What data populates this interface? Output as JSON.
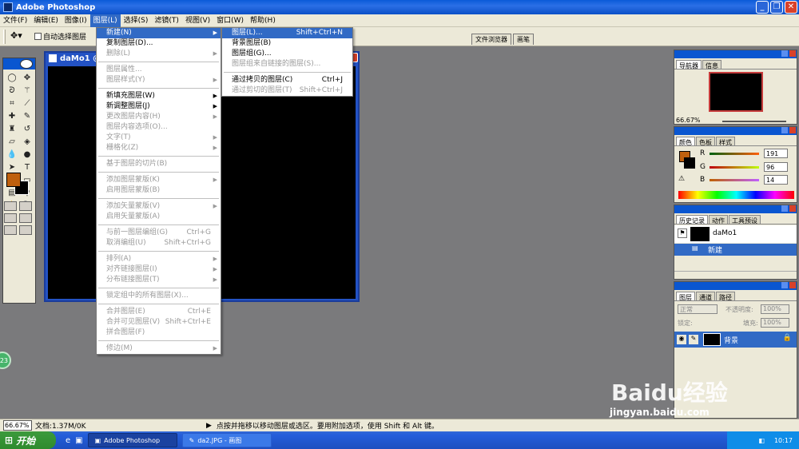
{
  "window": {
    "title": "Adobe Photoshop"
  },
  "menubar": {
    "items": [
      "文件(F)",
      "编辑(E)",
      "图像(I)",
      "图层(L)",
      "选择(S)",
      "滤镜(T)",
      "视图(V)",
      "窗口(W)",
      "帮助(H)"
    ]
  },
  "options": {
    "auto_select_label": "自动选择图层"
  },
  "well_tabs": [
    "文件浏览器",
    "画笔"
  ],
  "document": {
    "title": "daMo1 @"
  },
  "layer_menu": {
    "items": [
      {
        "label": "新建(N)",
        "state": "highlight",
        "arrow": true
      },
      {
        "label": "复制图层(D)...",
        "state": "normal"
      },
      {
        "label": "删除(L)",
        "state": "disabled",
        "arrow": true
      },
      {
        "sep": true
      },
      {
        "label": "图层属性...",
        "state": "disabled"
      },
      {
        "label": "图层样式(Y)",
        "state": "disabled",
        "arrow": true
      },
      {
        "sep": true
      },
      {
        "label": "新填充图层(W)",
        "state": "normal",
        "arrow": true
      },
      {
        "label": "新调整图层(J)",
        "state": "normal",
        "arrow": true
      },
      {
        "label": "更改图层内容(H)",
        "state": "disabled",
        "arrow": true
      },
      {
        "label": "图层内容选项(O)...",
        "state": "disabled"
      },
      {
        "label": "文字(T)",
        "state": "disabled",
        "arrow": true
      },
      {
        "label": "栅格化(Z)",
        "state": "disabled",
        "arrow": true
      },
      {
        "sep": true
      },
      {
        "label": "基于图层的切片(B)",
        "state": "disabled"
      },
      {
        "sep": true
      },
      {
        "label": "添加图层蒙版(K)",
        "state": "disabled",
        "arrow": true
      },
      {
        "label": "启用图层蒙版(B)",
        "state": "disabled"
      },
      {
        "sep": true
      },
      {
        "label": "添加矢量蒙版(V)",
        "state": "disabled",
        "arrow": true
      },
      {
        "label": "启用矢量蒙版(A)",
        "state": "disabled"
      },
      {
        "sep": true
      },
      {
        "label": "与前一图层编组(G)",
        "state": "disabled",
        "shortcut": "Ctrl+G"
      },
      {
        "label": "取消编组(U)",
        "state": "disabled",
        "shortcut": "Shift+Ctrl+G"
      },
      {
        "sep": true
      },
      {
        "label": "排列(A)",
        "state": "disabled",
        "arrow": true
      },
      {
        "label": "对齐链接图层(I)",
        "state": "disabled",
        "arrow": true
      },
      {
        "label": "分布链接图层(T)",
        "state": "disabled",
        "arrow": true
      },
      {
        "sep": true
      },
      {
        "label": "锁定组中的所有图层(X)...",
        "state": "disabled"
      },
      {
        "sep": true
      },
      {
        "label": "合并图层(E)",
        "state": "disabled",
        "shortcut": "Ctrl+E"
      },
      {
        "label": "合并可见图层(V)",
        "state": "disabled",
        "shortcut": "Shift+Ctrl+E"
      },
      {
        "label": "拼合图层(F)",
        "state": "disabled"
      },
      {
        "sep": true
      },
      {
        "label": "修边(M)",
        "state": "disabled",
        "arrow": true
      }
    ]
  },
  "new_submenu": {
    "items": [
      {
        "label": "图层(L)...",
        "state": "highlight",
        "shortcut": "Shift+Ctrl+N"
      },
      {
        "label": "背景图层(B)",
        "state": "normal"
      },
      {
        "label": "图层组(G)...",
        "state": "normal"
      },
      {
        "label": "图层组来自链接的图层(S)...",
        "state": "disabled"
      },
      {
        "sep": true
      },
      {
        "label": "通过拷贝的图层(C)",
        "state": "normal",
        "shortcut": "Ctrl+J"
      },
      {
        "label": "通过剪切的图层(T)",
        "state": "disabled",
        "shortcut": "Shift+Ctrl+J"
      }
    ]
  },
  "navigator": {
    "tabs": [
      "导航器",
      "信息"
    ],
    "zoom": "66.67%"
  },
  "color": {
    "tabs": [
      "颜色",
      "色板",
      "样式"
    ],
    "r_label": "R",
    "g_label": "G",
    "b_label": "B",
    "r": "191",
    "g": "96",
    "b": "14",
    "foreground": "#bf600e"
  },
  "history": {
    "tabs": [
      "历史记录",
      "动作",
      "工具预设"
    ],
    "snapshot": "daMo1",
    "step": "新建"
  },
  "layers": {
    "tabs": [
      "图层",
      "通道",
      "路径"
    ],
    "blend_mode": "正常",
    "opacity_label": "不透明度:",
    "opacity": "100%",
    "lock_label": "锁定:",
    "fill_label": "填充:",
    "fill": "100%",
    "layer_name": "背景"
  },
  "status": {
    "zoom": "66.67%",
    "doc": "文档:1.37M/0K",
    "hint": "点按并拖移以移动图层或选区。要用附加选项，使用 Shift 和 Alt 键。"
  },
  "taskbar": {
    "start": "开始",
    "tasks": [
      "Adobe Photoshop",
      "da2.JPG - 画图"
    ],
    "clock": "10:17"
  },
  "overlay": {
    "badge": "23",
    "watermark": "Baidu经验",
    "watermark_url": "jingyan.baidu.com"
  }
}
